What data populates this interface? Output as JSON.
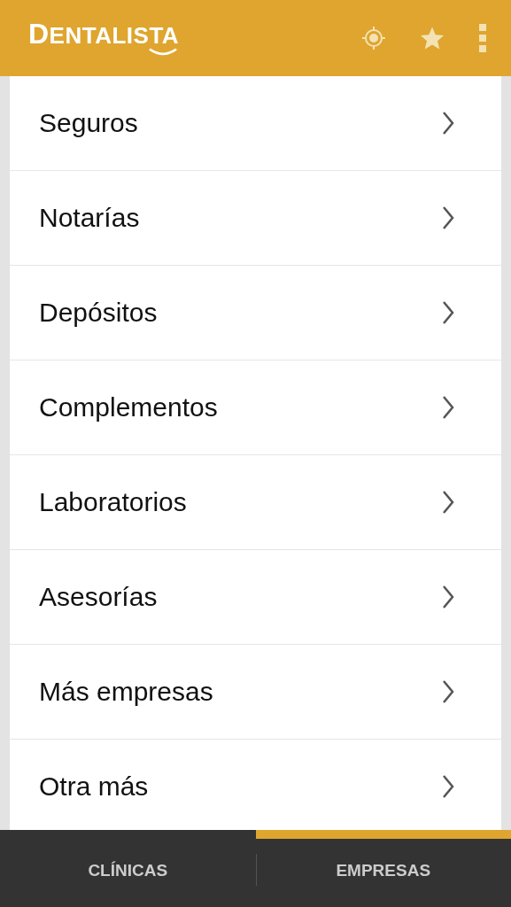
{
  "app_bar": {
    "logo": "DENTALISTA"
  },
  "items": [
    {
      "label": "Seguros"
    },
    {
      "label": "Notarías"
    },
    {
      "label": "Depósitos"
    },
    {
      "label": "Complementos"
    },
    {
      "label": "Laboratorios"
    },
    {
      "label": "Asesorías"
    },
    {
      "label": "Más empresas"
    },
    {
      "label": "Otra más"
    }
  ],
  "tabs": [
    {
      "label": "CLÍNICAS",
      "selected": false
    },
    {
      "label": "EMPRESAS",
      "selected": true
    }
  ]
}
